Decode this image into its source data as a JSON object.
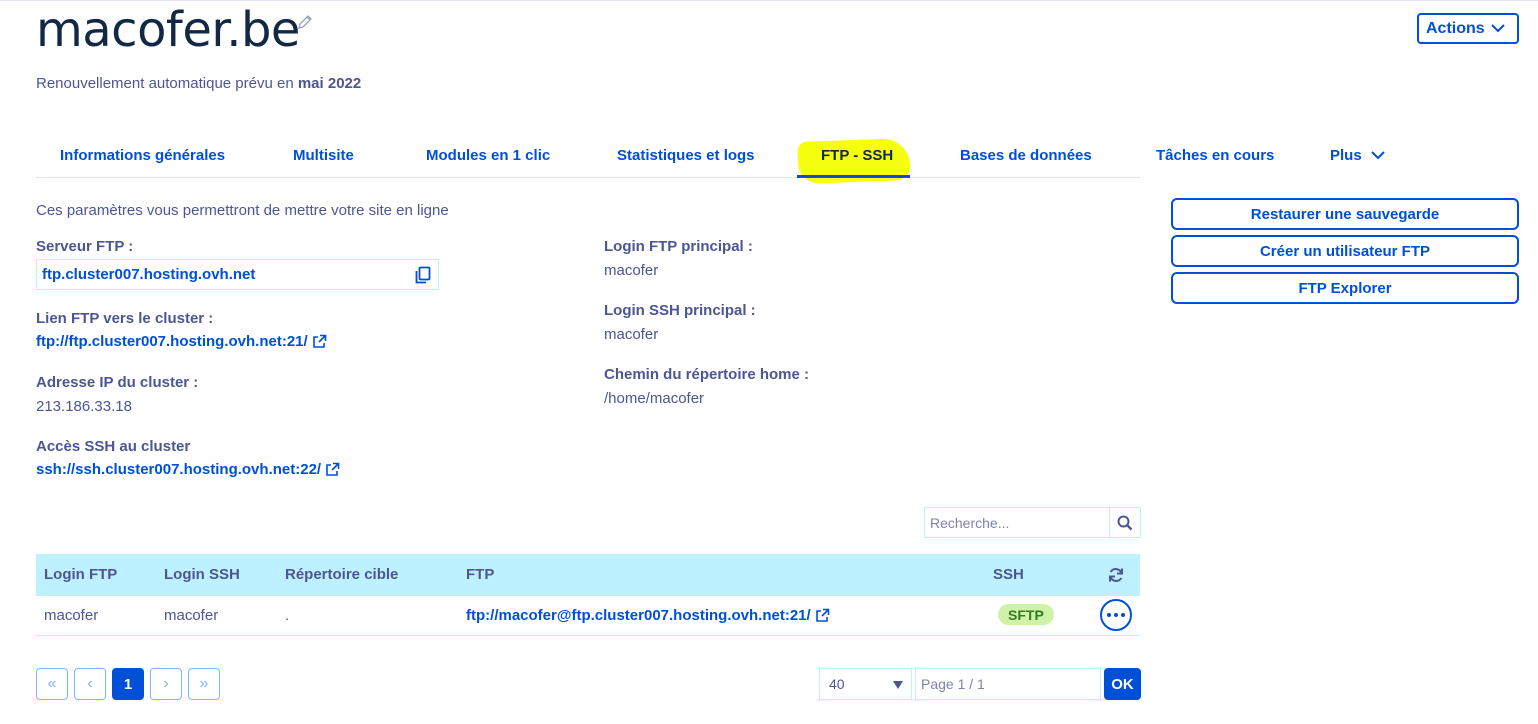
{
  "header": {
    "title": "macofer.be",
    "renew_prefix": "Renouvellement automatique prévu en",
    "renew_date": "mai 2022",
    "actions_label": "Actions"
  },
  "tabs": [
    {
      "label": "Informations générales"
    },
    {
      "label": "Multisite"
    },
    {
      "label": "Modules en 1 clic"
    },
    {
      "label": "Statistiques et logs"
    },
    {
      "label": "FTP - SSH",
      "active": true
    },
    {
      "label": "Bases de données"
    },
    {
      "label": "Tâches en cours"
    },
    {
      "label": "Plus"
    }
  ],
  "info": {
    "intro": "Ces paramètres vous permettront de mettre votre site en ligne",
    "ftp_server_label": "Serveur FTP :",
    "ftp_server_value": "ftp.cluster007.hosting.ovh.net",
    "ftp_link_label": "Lien FTP vers le cluster :",
    "ftp_link_value": "ftp://ftp.cluster007.hosting.ovh.net:21/",
    "ip_label": "Adresse IP du cluster :",
    "ip_value": "213.186.33.18",
    "ssh_label": "Accès SSH au cluster",
    "ssh_value": "ssh://ssh.cluster007.hosting.ovh.net:22/",
    "login_ftp_label": "Login FTP principal :",
    "login_ftp_value": "macofer",
    "login_ssh_label": "Login SSH principal :",
    "login_ssh_value": "macofer",
    "home_label": "Chemin du répertoire home :",
    "home_value": "/home/macofer"
  },
  "side_actions": [
    "Restaurer une sauvegarde",
    "Créer un utilisateur FTP",
    "FTP Explorer"
  ],
  "search": {
    "placeholder": "Recherche..."
  },
  "table": {
    "columns": [
      "Login FTP",
      "Login SSH",
      "Répertoire cible",
      "FTP",
      "SSH"
    ],
    "rows": [
      {
        "login_ftp": "macofer",
        "login_ssh": "macofer",
        "target_dir": ".",
        "ftp": "ftp://macofer@ftp.cluster007.hosting.ovh.net:21/",
        "ssh": "SFTP"
      }
    ]
  },
  "pagination": {
    "first": "«",
    "prev": "‹",
    "current": "1",
    "next": "›",
    "last": "»",
    "page_size": "40",
    "page_placeholder": "Page 1 / 1",
    "ok_label": "OK"
  },
  "colors": {
    "primary": "#0050d7",
    "text": "#4d5693",
    "header_bg": "#bef1ff",
    "highlight": "#f5ff00",
    "badge_bg": "#cff2a8"
  },
  "icons": [
    "edit-icon",
    "chevron-down-icon",
    "copy-icon",
    "external-link-icon",
    "search-icon",
    "refresh-icon",
    "more-icon"
  ]
}
